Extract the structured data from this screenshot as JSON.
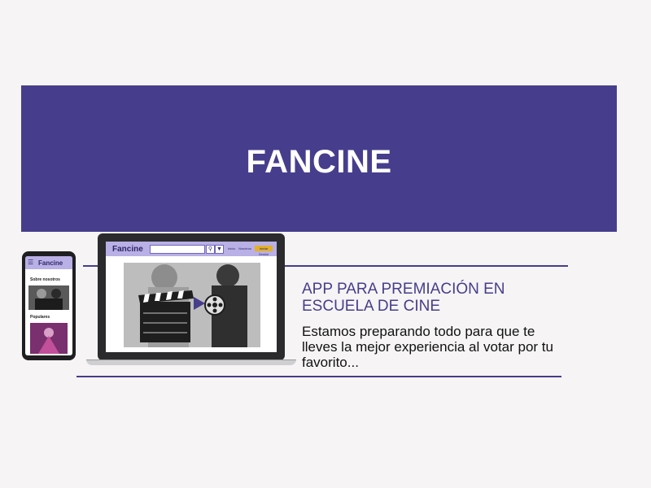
{
  "hero": {
    "title": "FANCINE"
  },
  "laptop_app": {
    "logo": "Fancine",
    "search_icon": "search-icon",
    "filter_icon": "filter-icon",
    "nav_link_1": "Inicio",
    "nav_link_2": "Nosotros",
    "cta_label": "Iniciar Sesión"
  },
  "phone_app": {
    "menu_icon": "menu-icon",
    "logo": "Fancine",
    "section_1": "Sobre nosotros",
    "section_2": "Populares"
  },
  "content": {
    "headline": "APP PARA PREMIACIÓN EN ESCUELA DE CINE",
    "body": "Estamos preparando todo para que te lleves la mejor experiencia al votar por tu favorito..."
  },
  "colors": {
    "brand_purple": "#463e8c",
    "light_purple": "#b9b0e6",
    "accent_yellow": "#e3b02a",
    "background": "#f6f4f4"
  }
}
